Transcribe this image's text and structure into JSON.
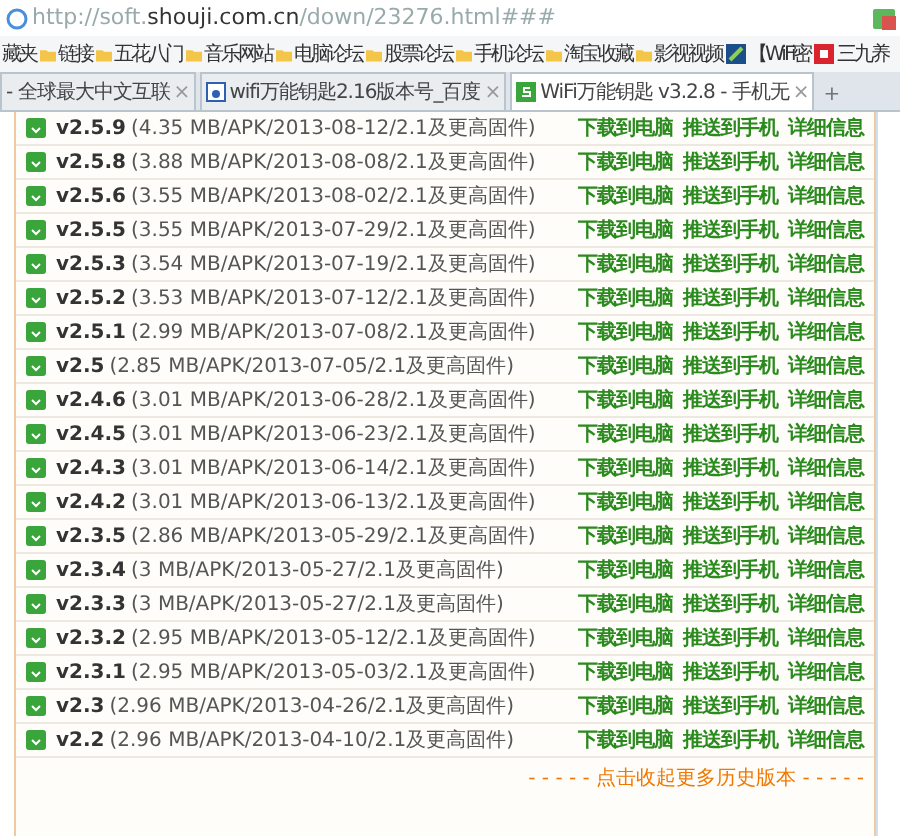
{
  "address_bar": {
    "url": "http://soft.**shouji.com.cn**/down/23276.html###"
  },
  "bookmarks": [
    {
      "label": "藏夹",
      "kind": "plain"
    },
    {
      "label": "链接",
      "kind": "folder"
    },
    {
      "label": "五花八门",
      "kind": "folder"
    },
    {
      "label": "音乐网站",
      "kind": "folder"
    },
    {
      "label": "电脑论坛",
      "kind": "folder"
    },
    {
      "label": "股票论坛",
      "kind": "folder"
    },
    {
      "label": "手机论坛",
      "kind": "folder"
    },
    {
      "label": "淘宝收藏",
      "kind": "folder"
    },
    {
      "label": "影视视频",
      "kind": "folder"
    },
    {
      "label": "【WiFi密",
      "kind": "site"
    },
    {
      "label": "三九养",
      "kind": "site2"
    }
  ],
  "tabs": [
    {
      "title": "- 全球最大中文互联",
      "selected": false,
      "close": "×"
    },
    {
      "title": "wifi万能钥匙2.16版本号_百度",
      "selected": false,
      "close": "×"
    },
    {
      "title": "WiFi万能钥匙 v3.2.8 - 手机无",
      "selected": true,
      "close": "×"
    }
  ],
  "new_tab": "+",
  "versions": [
    {
      "version": "v2.5.9",
      "info": "(4.35 MB/APK/2013-08-12/2.1及更高固件)",
      "links": [
        "下载到电脑",
        "推送到手机",
        "详细信息"
      ]
    },
    {
      "version": "v2.5.8",
      "info": "(3.88 MB/APK/2013-08-08/2.1及更高固件)",
      "links": [
        "下载到电脑",
        "推送到手机",
        "详细信息"
      ]
    },
    {
      "version": "v2.5.6",
      "info": "(3.55 MB/APK/2013-08-02/2.1及更高固件)",
      "links": [
        "下载到电脑",
        "推送到手机",
        "详细信息"
      ]
    },
    {
      "version": "v2.5.5",
      "info": "(3.55 MB/APK/2013-07-29/2.1及更高固件)",
      "links": [
        "下载到电脑",
        "推送到手机",
        "详细信息"
      ]
    },
    {
      "version": "v2.5.3",
      "info": "(3.54 MB/APK/2013-07-19/2.1及更高固件)",
      "links": [
        "下载到电脑",
        "推送到手机",
        "详细信息"
      ]
    },
    {
      "version": "v2.5.2",
      "info": "(3.53 MB/APK/2013-07-12/2.1及更高固件)",
      "links": [
        "下载到电脑",
        "推送到手机",
        "详细信息"
      ]
    },
    {
      "version": "v2.5.1",
      "info": "(2.99 MB/APK/2013-07-08/2.1及更高固件)",
      "links": [
        "下载到电脑",
        "推送到手机",
        "详细信息"
      ]
    },
    {
      "version": "v2.5",
      "info": "(2.85 MB/APK/2013-07-05/2.1及更高固件)",
      "links": [
        "下载到电脑",
        "推送到手机",
        "详细信息"
      ]
    },
    {
      "version": "v2.4.6",
      "info": "(3.01 MB/APK/2013-06-28/2.1及更高固件)",
      "links": [
        "下载到电脑",
        "推送到手机",
        "详细信息"
      ]
    },
    {
      "version": "v2.4.5",
      "info": "(3.01 MB/APK/2013-06-23/2.1及更高固件)",
      "links": [
        "下载到电脑",
        "推送到手机",
        "详细信息"
      ]
    },
    {
      "version": "v2.4.3",
      "info": "(3.01 MB/APK/2013-06-14/2.1及更高固件)",
      "links": [
        "下载到电脑",
        "推送到手机",
        "详细信息"
      ]
    },
    {
      "version": "v2.4.2",
      "info": "(3.01 MB/APK/2013-06-13/2.1及更高固件)",
      "links": [
        "下载到电脑",
        "推送到手机",
        "详细信息"
      ]
    },
    {
      "version": "v2.3.5",
      "info": "(2.86 MB/APK/2013-05-29/2.1及更高固件)",
      "links": [
        "下载到电脑",
        "推送到手机",
        "详细信息"
      ]
    },
    {
      "version": "v2.3.4",
      "info": "(3 MB/APK/2013-05-27/2.1及更高固件)",
      "links": [
        "下载到电脑",
        "推送到手机",
        "详细信息"
      ]
    },
    {
      "version": "v2.3.3",
      "info": "(3 MB/APK/2013-05-27/2.1及更高固件)",
      "links": [
        "下载到电脑",
        "推送到手机",
        "详细信息"
      ]
    },
    {
      "version": "v2.3.2",
      "info": "(2.95 MB/APK/2013-05-12/2.1及更高固件)",
      "links": [
        "下载到电脑",
        "推送到手机",
        "详细信息"
      ]
    },
    {
      "version": "v2.3.1",
      "info": "(2.95 MB/APK/2013-05-03/2.1及更高固件)",
      "links": [
        "下载到电脑",
        "推送到手机",
        "详细信息"
      ]
    },
    {
      "version": "v2.3",
      "info": "(2.96 MB/APK/2013-04-26/2.1及更高固件)",
      "links": [
        "下载到电脑",
        "推送到手机",
        "详细信息"
      ]
    },
    {
      "version": "v2.2",
      "info": "(2.96 MB/APK/2013-04-10/2.1及更高固件)",
      "links": [
        "下载到电脑",
        "推送到手机",
        "详细信息"
      ]
    }
  ],
  "collapse_link": "- - - - - 点击收起更多历史版本 - - - - -"
}
